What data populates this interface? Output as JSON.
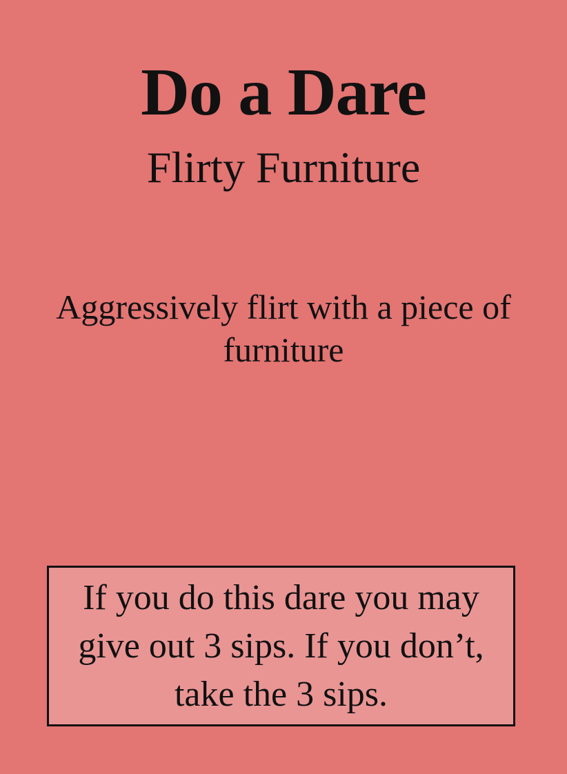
{
  "card": {
    "title": "Do a Dare",
    "subtitle": "Flirty Furniture",
    "dare": "Aggressively flirt with a piece of furniture",
    "rule": "If you do this dare you may give out 3 sips. If you don’t, take the 3 sips."
  },
  "colors": {
    "background": "#e37573",
    "rule_box": "#e99594",
    "text": "#111111"
  }
}
